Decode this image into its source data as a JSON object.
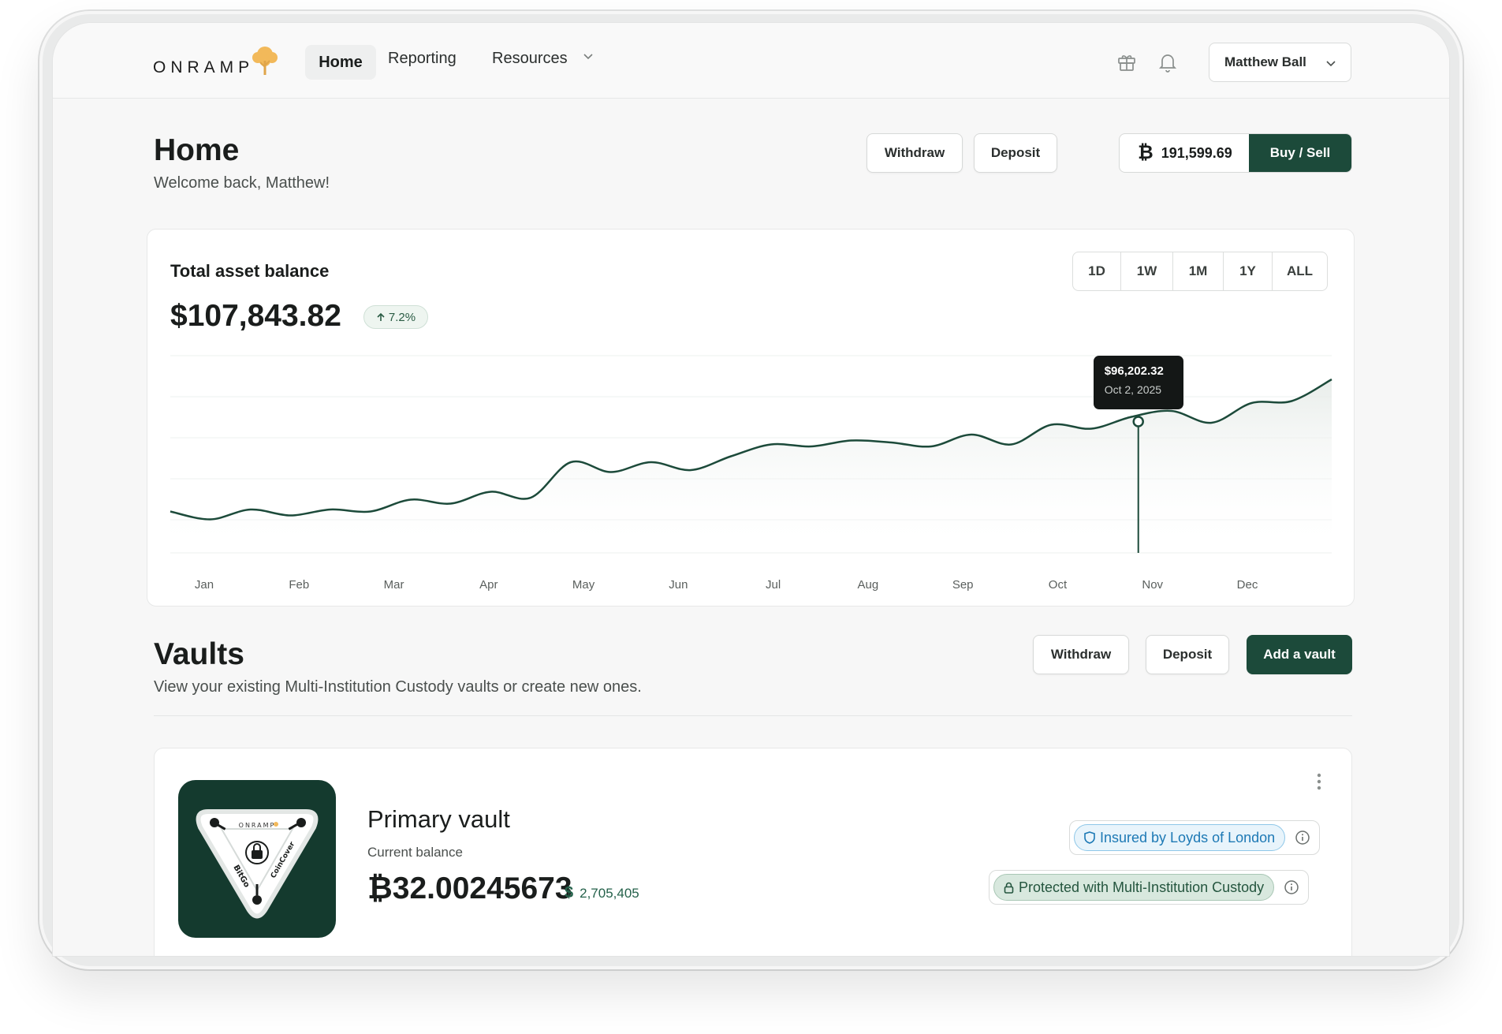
{
  "nav": {
    "logo_text": "ONRAMP",
    "items": [
      {
        "label": "Home",
        "active": true
      },
      {
        "label": "Reporting"
      },
      {
        "label": "Resources"
      }
    ],
    "user_name": "Matthew Ball"
  },
  "header": {
    "title": "Home",
    "subtitle": "Welcome back, Matthew!",
    "withdraw_label": "Withdraw",
    "deposit_label": "Deposit",
    "btc_symbol": "₿",
    "btc_price": "191,599.69",
    "buy_sell_label": "Buy / Sell"
  },
  "balance_card": {
    "title": "Total asset balance",
    "value": "$107,843.82",
    "change": "7.2%",
    "ranges": [
      "1D",
      "1W",
      "1M",
      "1Y",
      "ALL"
    ],
    "tooltip": {
      "value": "$96,202.32",
      "date": "Oct 2, 2025"
    }
  },
  "chart_data": {
    "type": "area",
    "categories": [
      "Jan",
      "Feb",
      "Mar",
      "Apr",
      "May",
      "Jun",
      "Jul",
      "Aug",
      "Sep",
      "Oct",
      "Nov",
      "Dec"
    ],
    "series": [
      {
        "values": [
          0.21,
          0.17,
          0.22,
          0.19,
          0.22,
          0.21,
          0.27,
          0.25,
          0.31,
          0.28,
          0.46,
          0.41,
          0.46,
          0.42,
          0.49,
          0.55,
          0.54,
          0.57,
          0.56,
          0.54,
          0.6,
          0.55,
          0.65,
          0.63,
          0.69,
          0.72,
          0.66,
          0.76,
          0.77,
          0.88
        ]
      }
    ],
    "y_axis_labels_shown": false,
    "grid": true,
    "accent": "#1c4a3a",
    "highlight": {
      "x": "Nov",
      "value": "$96,202.32",
      "date": "Oct 2, 2025"
    }
  },
  "vaults": {
    "title": "Vaults",
    "subtitle": "View your existing Multi-Institution Custody vaults or create new ones.",
    "withdraw_label": "Withdraw",
    "deposit_label": "Deposit",
    "add_label": "Add a vault",
    "primary": {
      "name": "Primary vault",
      "balance_label": "Current balance",
      "btc_balance": "₿32.00245673",
      "usd_symbol": "$",
      "usd_balance": "2,705,405",
      "logo_text": "ONRAMP",
      "logo_partner_left": "BitGo",
      "logo_partner_right": "CoinCover",
      "badge_insured": "Insured by Loyds of London",
      "badge_protected": "Protected with Multi-Institution Custody"
    }
  },
  "colors": {
    "brand_green": "#1c4a3a",
    "logo_tree": "#f2b95a",
    "insured_blue": "#1d79b5"
  }
}
